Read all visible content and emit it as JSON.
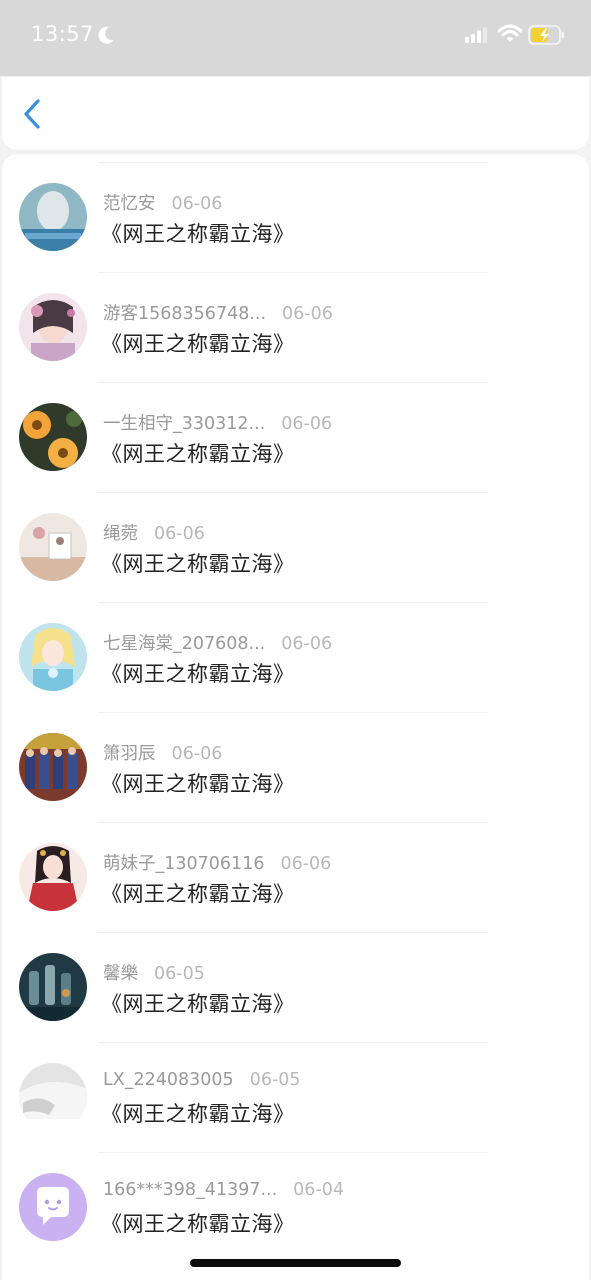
{
  "status_bar": {
    "time": "13:57",
    "icons": [
      "moon-icon",
      "cellular-signal-icon",
      "wifi-icon",
      "battery-charging-icon"
    ],
    "battery_color": "#f5d130"
  },
  "nav": {
    "back_icon": "chevron-left-icon",
    "accent_color": "#3a8de0"
  },
  "comments": [
    {
      "user": "范忆安",
      "date": "06-06",
      "text": "《网王之称霸立海》"
    },
    {
      "user": "游客1568356748...",
      "date": "06-06",
      "text": "《网王之称霸立海》"
    },
    {
      "user": "一生相守_330312...",
      "date": "06-06",
      "text": "《网王之称霸立海》"
    },
    {
      "user": "绳菀",
      "date": "06-06",
      "text": "《网王之称霸立海》"
    },
    {
      "user": "七星海棠_207608...",
      "date": "06-06",
      "text": "《网王之称霸立海》"
    },
    {
      "user": "箫羽辰",
      "date": "06-06",
      "text": "《网王之称霸立海》"
    },
    {
      "user": "萌妹子_130706116",
      "date": "06-06",
      "text": "《网王之称霸立海》"
    },
    {
      "user": "馨樂",
      "date": "06-05",
      "text": "《网王之称霸立海》"
    },
    {
      "user": "LX_224083005",
      "date": "06-05",
      "text": "《网王之称霸立海》"
    },
    {
      "user": "166***398_41397...",
      "date": "06-04",
      "text": "《网王之称霸立海》"
    }
  ]
}
